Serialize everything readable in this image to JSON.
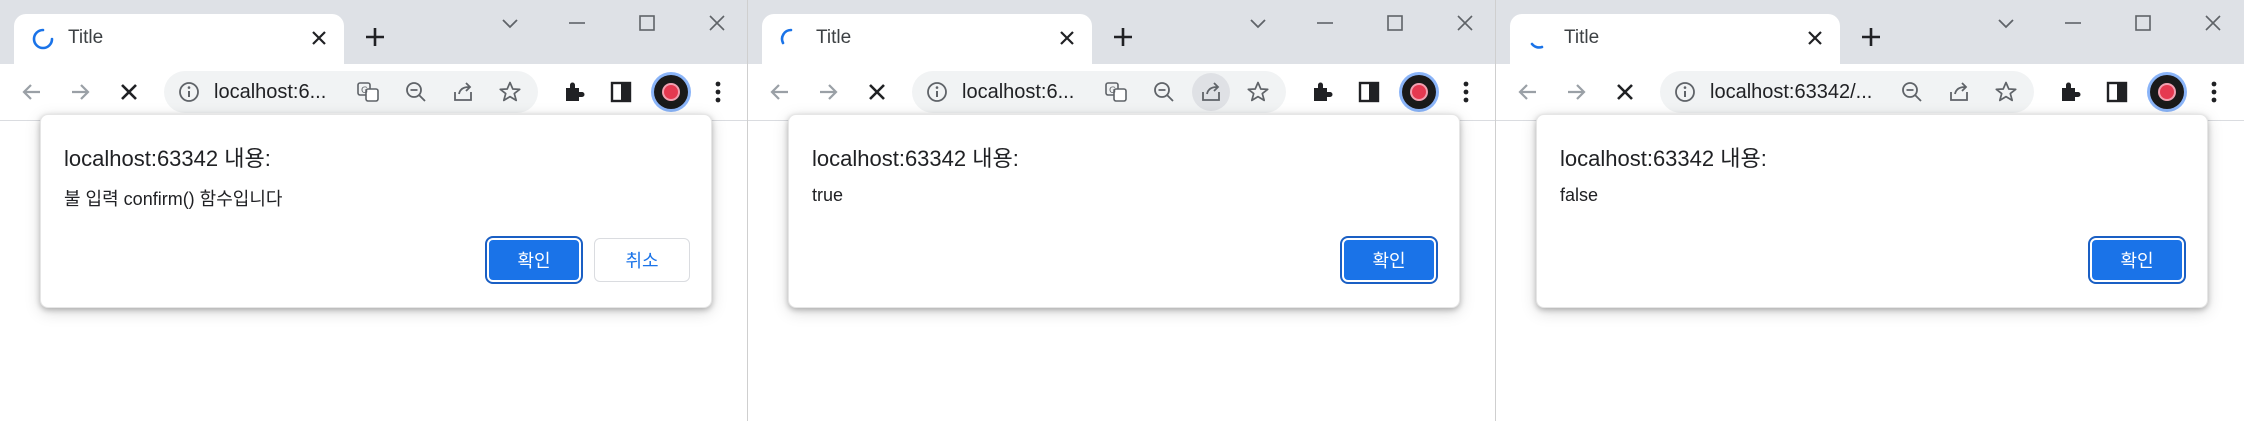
{
  "windows": [
    {
      "tab_title": "Title",
      "url": "localhost:6...",
      "dialog": {
        "title": "localhost:63342 내용:",
        "message": "불 입력 confirm() 함수입니다",
        "ok_label": "확인",
        "cancel_label": "취소"
      }
    },
    {
      "tab_title": "Title",
      "url": "localhost:6...",
      "dialog": {
        "title": "localhost:63342 내용:",
        "message": "true",
        "ok_label": "확인"
      }
    },
    {
      "tab_title": "Title",
      "url": "localhost:63342/...",
      "dialog": {
        "title": "localhost:63342 내용:",
        "message": "false",
        "ok_label": "확인"
      }
    }
  ],
  "colors": {
    "accent": "#1a73e8",
    "tabstrip": "#dee1e6",
    "omnibox": "#f1f3f4"
  },
  "icons": [
    "loading-spinner-icon",
    "close-icon",
    "plus-icon",
    "chevron-down-icon",
    "minimize-icon",
    "maximize-icon",
    "back-icon",
    "forward-icon",
    "stop-icon",
    "info-icon",
    "translate-icon",
    "zoom-out-icon",
    "share-icon",
    "star-icon",
    "extensions-icon",
    "side-panel-icon",
    "avatar",
    "menu-icon"
  ]
}
